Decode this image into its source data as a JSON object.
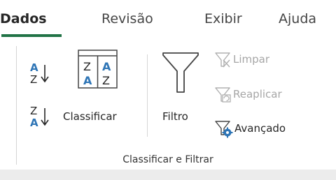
{
  "tabs": {
    "items": [
      {
        "label": "Dados",
        "active": true
      },
      {
        "label": "Revisão",
        "active": false
      },
      {
        "label": "Exibir",
        "active": false
      },
      {
        "label": "Ajuda",
        "active": false
      }
    ],
    "accent_color": "#217346"
  },
  "ribbon": {
    "sort_az_icon": "sort-a-to-z-icon",
    "sort_za_icon": "sort-z-to-a-icon",
    "sort_glyphs": {
      "a": "A",
      "z": "Z"
    },
    "classificar": {
      "label": "Classificar",
      "icon": "sort-dialog-icon"
    },
    "filtro": {
      "label": "Filtro",
      "icon": "funnel-filter-icon"
    },
    "limpar": {
      "label": "Limpar",
      "icon": "clear-filter-icon",
      "enabled": false
    },
    "reaplicar": {
      "label": "Reaplicar",
      "icon": "reapply-filter-icon",
      "enabled": false
    },
    "avancado": {
      "label": "Avançado",
      "icon": "advanced-filter-icon",
      "enabled": true
    },
    "group_label": "Classificar e Filtrar",
    "icon_blue": "#2e75b6",
    "disabled_color": "#a6a6a6"
  }
}
